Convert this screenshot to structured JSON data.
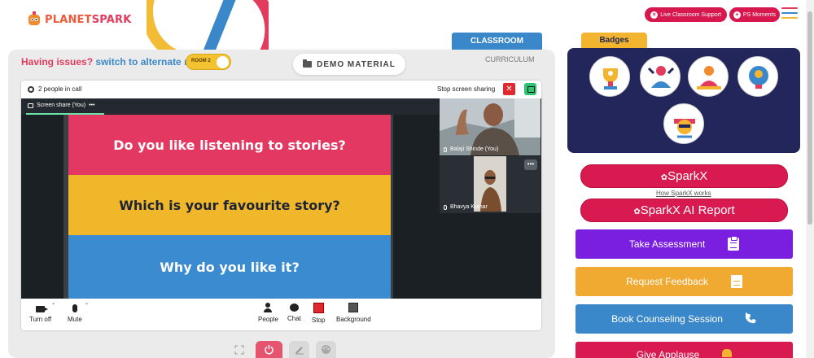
{
  "brand": {
    "name_part1": "PLANET",
    "name_part2": "SPARK"
  },
  "header": {
    "live_support": "Live Classroom Support",
    "ps_moments": "PS Moments"
  },
  "issue": {
    "prefix": "Having issues?",
    "link": "switch to alternate room",
    "room_label": "ROOM 2"
  },
  "demo_material": "DEMO MATERIAL",
  "tabs": {
    "classroom": "CLASSROOM",
    "curriculum": "CURRICULUM"
  },
  "call": {
    "people_count": "2 people in call",
    "stop_sharing": "Stop screen sharing",
    "screen_share_label": "Screen share (You)",
    "participants": [
      {
        "name": "Balaji Shinde (You)"
      },
      {
        "name": "Bhavya Kumar"
      }
    ],
    "slide": [
      "Do you like listening to stories?",
      "Which is your favourite story?",
      "Why do you like it?"
    ],
    "controls": {
      "turn_off": "Turn off",
      "mute": "Mute",
      "people": "People",
      "chat": "Chat",
      "stop": "Stop",
      "background": "Background"
    }
  },
  "badges": {
    "title": "Badges"
  },
  "right": {
    "sparkx": "SparkX",
    "how_sparkx": "How SparkX works",
    "sparkx_report": "SparkX AI Report",
    "take_assessment": "Take Assessment",
    "request_feedback": "Request Feedback",
    "book_counseling": "Book Counseling Session",
    "give_applause": "Give Applause"
  },
  "colors": {
    "brand_red": "#d91a50",
    "brand_blue": "#3a88c9",
    "purple": "#7a1ee0",
    "orange": "#f0aa32",
    "navy": "#22265a",
    "gold": "#f3b52f"
  }
}
